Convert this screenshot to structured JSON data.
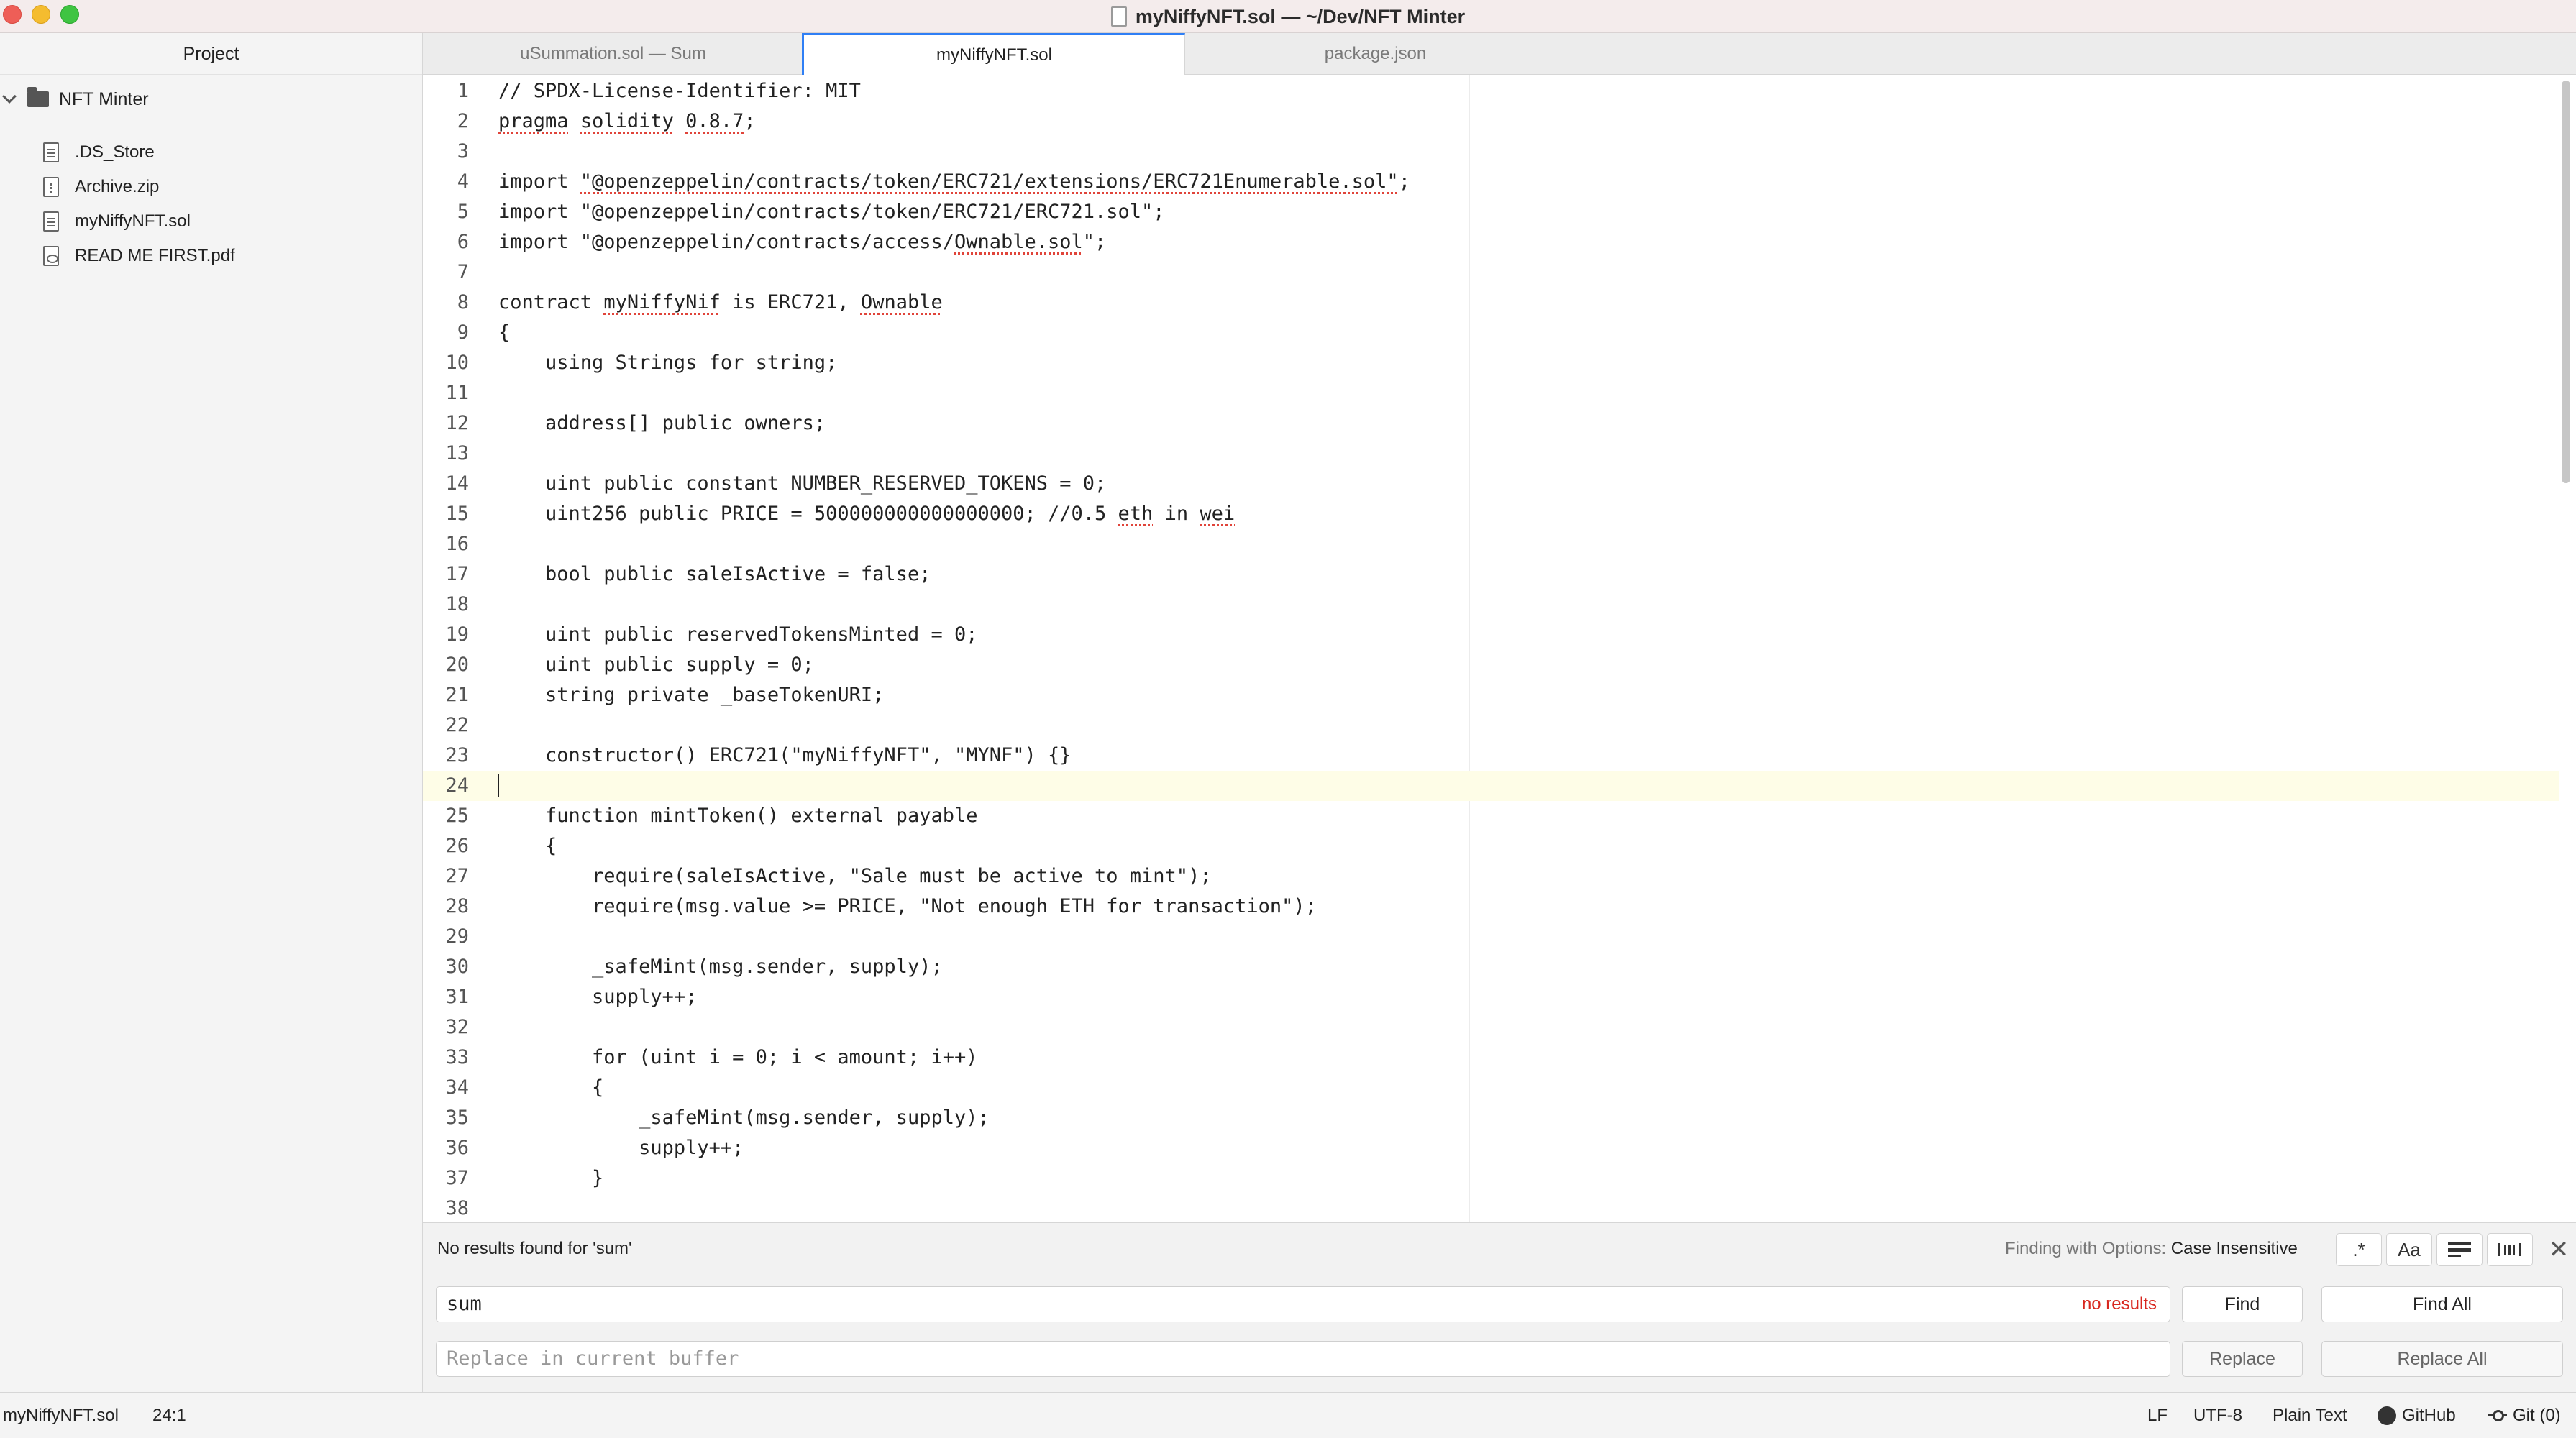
{
  "window": {
    "title": "myNiffyNFT.sol — ~/Dev/NFT Minter"
  },
  "sidebar": {
    "header": "Project",
    "root": "NFT Minter",
    "files": [
      ".DS_Store",
      "Archive.zip",
      "myNiffyNFT.sol",
      "READ ME FIRST.pdf"
    ]
  },
  "tabs": [
    {
      "label": "uSummation.sol — Sum"
    },
    {
      "label": "myNiffyNFT.sol"
    },
    {
      "label": "package.json"
    }
  ],
  "editor": {
    "current_line": 24,
    "lines": [
      {
        "n": "1",
        "t": "// SPDX-License-Identifier: MIT"
      },
      {
        "n": "2",
        "t": "pragma solidity 0.8.7;"
      },
      {
        "n": "3",
        "t": ""
      },
      {
        "n": "4",
        "t": "import \"@openzeppelin/contracts/token/ERC721/extensions/ERC721Enumerable.sol\";"
      },
      {
        "n": "5",
        "t": "import \"@openzeppelin/contracts/token/ERC721/ERC721.sol\";"
      },
      {
        "n": "6",
        "t": "import \"@openzeppelin/contracts/access/Ownable.sol\";"
      },
      {
        "n": "7",
        "t": ""
      },
      {
        "n": "8",
        "t": "contract myNiffyNif is ERC721, Ownable"
      },
      {
        "n": "9",
        "t": "{"
      },
      {
        "n": "10",
        "t": "    using Strings for string;"
      },
      {
        "n": "11",
        "t": ""
      },
      {
        "n": "12",
        "t": "    address[] public owners;"
      },
      {
        "n": "13",
        "t": ""
      },
      {
        "n": "14",
        "t": "    uint public constant NUMBER_RESERVED_TOKENS = 0;"
      },
      {
        "n": "15",
        "t": "    uint256 public PRICE = 500000000000000000; //0.5 eth in wei"
      },
      {
        "n": "16",
        "t": ""
      },
      {
        "n": "17",
        "t": "    bool public saleIsActive = false;"
      },
      {
        "n": "18",
        "t": ""
      },
      {
        "n": "19",
        "t": "    uint public reservedTokensMinted = 0;"
      },
      {
        "n": "20",
        "t": "    uint public supply = 0;"
      },
      {
        "n": "21",
        "t": "    string private _baseTokenURI;"
      },
      {
        "n": "22",
        "t": ""
      },
      {
        "n": "23",
        "t": "    constructor() ERC721(\"myNiffyNFT\", \"MYNF\") {}"
      },
      {
        "n": "24",
        "t": ""
      },
      {
        "n": "25",
        "t": "    function mintToken() external payable"
      },
      {
        "n": "26",
        "t": "    {"
      },
      {
        "n": "27",
        "t": "        require(saleIsActive, \"Sale must be active to mint\");"
      },
      {
        "n": "28",
        "t": "        require(msg.value >= PRICE, \"Not enough ETH for transaction\");"
      },
      {
        "n": "29",
        "t": ""
      },
      {
        "n": "30",
        "t": "        _safeMint(msg.sender, supply);"
      },
      {
        "n": "31",
        "t": "        supply++;"
      },
      {
        "n": "32",
        "t": ""
      },
      {
        "n": "33",
        "t": "        for (uint i = 0; i < amount; i++)"
      },
      {
        "n": "34",
        "t": "        {"
      },
      {
        "n": "35",
        "t": "            _safeMint(msg.sender, supply);"
      },
      {
        "n": "36",
        "t": "            supply++;"
      },
      {
        "n": "37",
        "t": "        }"
      },
      {
        "n": "38",
        "t": ""
      }
    ]
  },
  "find": {
    "message": "No results found for 'sum'",
    "options_label": "Finding with Options:",
    "options_value": "Case Insensitive",
    "option_buttons": [
      ".*",
      "Aa",
      "",
      ""
    ],
    "find_value": "sum",
    "result_badge": "no results",
    "replace_placeholder": "Replace in current buffer",
    "find_label": "Find",
    "find_all_label": "Find All",
    "replace_label": "Replace",
    "replace_all_label": "Replace All",
    "close_glyph": "✕"
  },
  "status": {
    "file": "myNiffyNFT.sol",
    "cursor": "24:1",
    "line_ending": "LF",
    "encoding": "UTF-8",
    "grammar": "Plain Text",
    "github": "GitHub",
    "git": "Git (0)"
  }
}
